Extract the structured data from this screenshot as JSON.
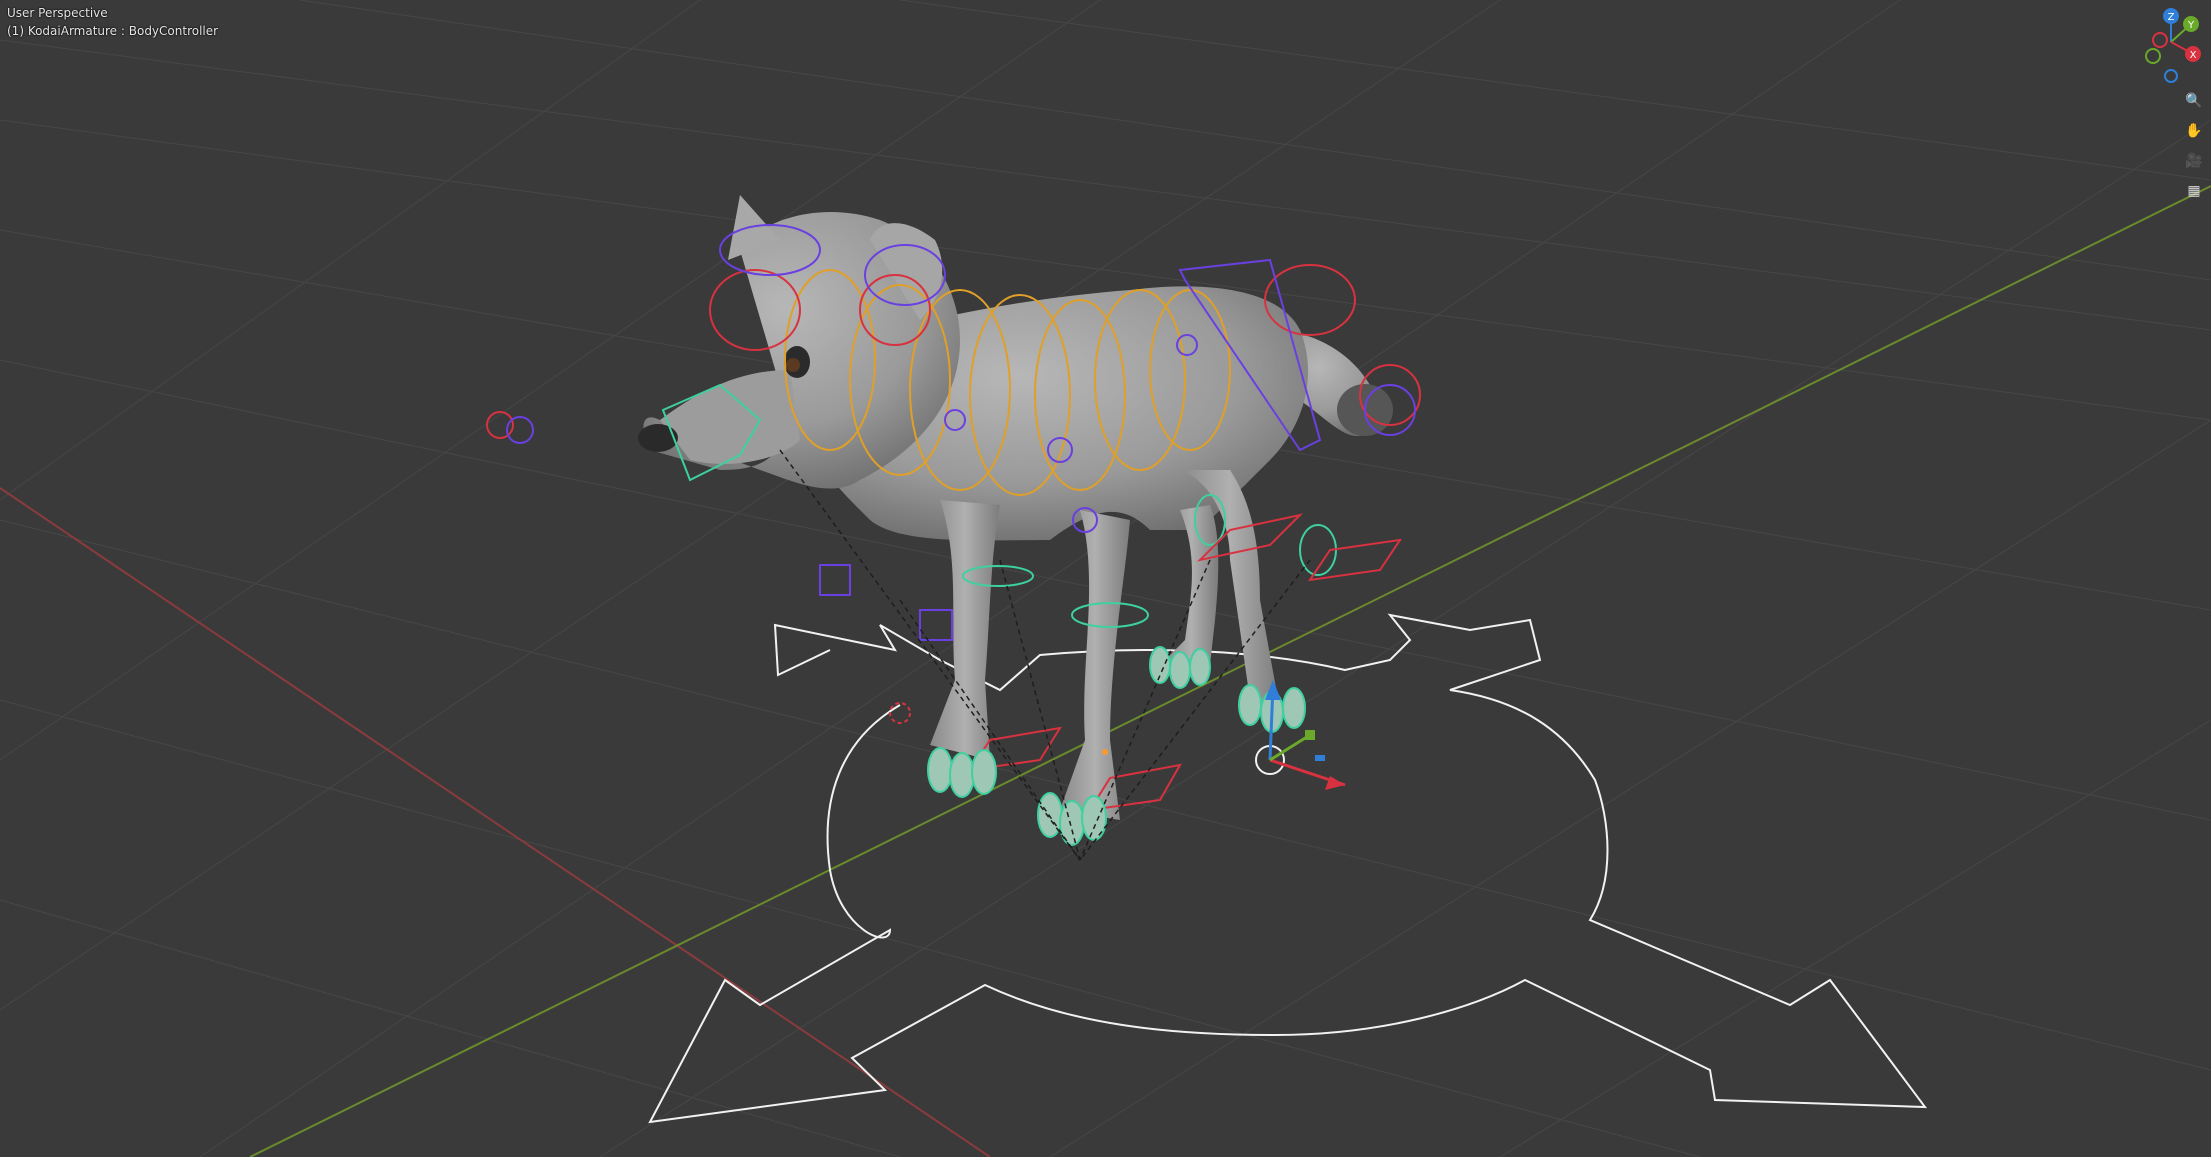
{
  "viewport": {
    "view_name": "User Perspective",
    "active_object": "(1) KodaiArmature : BodyController",
    "background": "#3a3a3a",
    "grid_color": "#474747",
    "x_axis_color": "#8a3b3d",
    "y_axis_color": "#6b8a2e"
  },
  "navigation_gizmo": {
    "axes": [
      {
        "label": "Z",
        "color": "#2f7fd8"
      },
      {
        "label": "Y",
        "color": "#6aa92a"
      },
      {
        "label": "X",
        "color": "#d8383f"
      }
    ]
  },
  "nav_buttons": [
    {
      "name": "zoom",
      "icon": "magnifier-icon",
      "glyph": "🔍"
    },
    {
      "name": "pan",
      "icon": "hand-icon",
      "glyph": "✋"
    },
    {
      "name": "camera",
      "icon": "camera-icon",
      "glyph": "🎥"
    },
    {
      "name": "ortho",
      "icon": "grid-icon",
      "glyph": "▦"
    }
  ],
  "scene": {
    "model": "wolf character mesh",
    "armature": "KodaiArmature",
    "controller": "BodyController",
    "rig_colors": {
      "spine": "#e0a028",
      "face": "#3ed0a0",
      "ik": "#d83240",
      "fk": "#6a40e0",
      "root": "#f2f2f2"
    }
  }
}
